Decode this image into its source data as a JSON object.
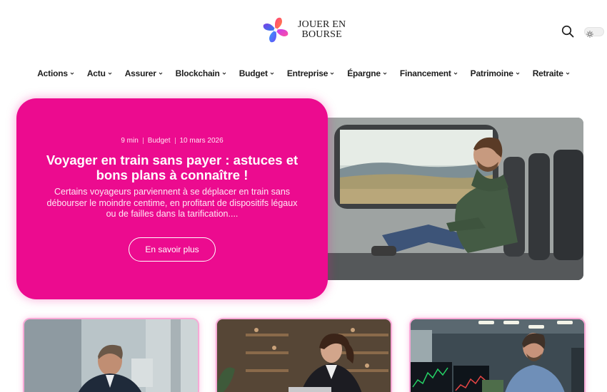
{
  "header": {
    "logo_line1": "JOUER EN",
    "logo_line2": "BOURSE",
    "logo_alt": "Jouer en Bourse logo",
    "search_icon": "search-icon",
    "theme_toggle_icon": "sun-icon"
  },
  "nav": {
    "items": [
      {
        "label": "Actions"
      },
      {
        "label": "Actu"
      },
      {
        "label": "Assurer"
      },
      {
        "label": "Blockchain"
      },
      {
        "label": "Budget"
      },
      {
        "label": "Entreprise"
      },
      {
        "label": "Épargne"
      },
      {
        "label": "Financement"
      },
      {
        "label": "Patrimoine"
      },
      {
        "label": "Retraite"
      }
    ]
  },
  "hero": {
    "read_time": "9 min",
    "category": "Budget",
    "date": "10 mars 2026",
    "title": "Voyager en train sans payer : astuces et bons plans à connaître !",
    "excerpt": "Certains voyageurs parviennent à se déplacer en train sans débourser le moindre centime, en profitant de dispositifs légaux ou de failles dans la tarification....",
    "button_label": "En savoir plus"
  },
  "colors": {
    "accent": "#ec0b8f",
    "nav_text": "#1d1d1d"
  }
}
